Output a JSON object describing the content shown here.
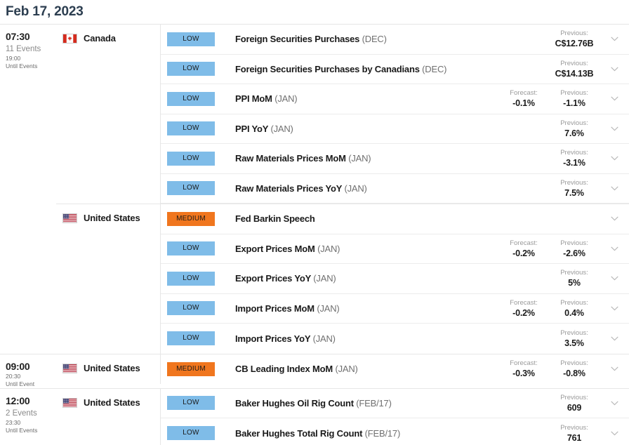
{
  "header": {
    "date": "Feb 17, 2023"
  },
  "labels": {
    "forecast": "Forecast:",
    "previous": "Previous:",
    "chevron_icon": "chevron-down-icon"
  },
  "groups": [
    {
      "time": "07:30",
      "events_count": "11 Events",
      "until_time": "19:00",
      "until_label": "Until Events",
      "countries": [
        {
          "name": "Canada",
          "flag": "canada-flag",
          "events": [
            {
              "impact": "LOW",
              "impact_level": "low",
              "title": "Foreign Securities Purchases",
              "period": "(DEC)",
              "forecast": "",
              "previous": "C$12.76B"
            },
            {
              "impact": "LOW",
              "impact_level": "low",
              "title": "Foreign Securities Purchases by Canadians",
              "period": "(DEC)",
              "forecast": "",
              "previous": "C$14.13B"
            },
            {
              "impact": "LOW",
              "impact_level": "low",
              "title": "PPI MoM",
              "period": "(JAN)",
              "forecast": "-0.1%",
              "previous": "-1.1%"
            },
            {
              "impact": "LOW",
              "impact_level": "low",
              "title": "PPI YoY",
              "period": "(JAN)",
              "forecast": "",
              "previous": "7.6%"
            },
            {
              "impact": "LOW",
              "impact_level": "low",
              "title": "Raw Materials Prices MoM",
              "period": "(JAN)",
              "forecast": "",
              "previous": "-3.1%"
            },
            {
              "impact": "LOW",
              "impact_level": "low",
              "title": "Raw Materials Prices YoY",
              "period": "(JAN)",
              "forecast": "",
              "previous": "7.5%"
            }
          ]
        },
        {
          "name": "United States",
          "flag": "usa-flag",
          "events": [
            {
              "impact": "MEDIUM",
              "impact_level": "medium",
              "title": "Fed Barkin Speech",
              "period": "",
              "forecast": "",
              "previous": ""
            },
            {
              "impact": "LOW",
              "impact_level": "low",
              "title": "Export Prices MoM",
              "period": "(JAN)",
              "forecast": "-0.2%",
              "previous": "-2.6%"
            },
            {
              "impact": "LOW",
              "impact_level": "low",
              "title": "Export Prices YoY",
              "period": "(JAN)",
              "forecast": "",
              "previous": "5%"
            },
            {
              "impact": "LOW",
              "impact_level": "low",
              "title": "Import Prices MoM",
              "period": "(JAN)",
              "forecast": "-0.2%",
              "previous": "0.4%"
            },
            {
              "impact": "LOW",
              "impact_level": "low",
              "title": "Import Prices YoY",
              "period": "(JAN)",
              "forecast": "",
              "previous": "3.5%"
            }
          ]
        }
      ]
    },
    {
      "time": "09:00",
      "events_count": "",
      "until_time": "20:30",
      "until_label": "Until Event",
      "countries": [
        {
          "name": "United States",
          "flag": "usa-flag",
          "events": [
            {
              "impact": "MEDIUM",
              "impact_level": "medium",
              "title": "CB Leading Index MoM",
              "period": "(JAN)",
              "forecast": "-0.3%",
              "previous": "-0.8%"
            }
          ]
        }
      ]
    },
    {
      "time": "12:00",
      "events_count": "2 Events",
      "until_time": "23:30",
      "until_label": "Until Events",
      "countries": [
        {
          "name": "United States",
          "flag": "usa-flag",
          "events": [
            {
              "impact": "LOW",
              "impact_level": "low",
              "title": "Baker Hughes Oil Rig Count",
              "period": "(FEB/17)",
              "forecast": "",
              "previous": "609"
            },
            {
              "impact": "LOW",
              "impact_level": "low",
              "title": "Baker Hughes Total Rig Count",
              "period": "(FEB/17)",
              "forecast": "",
              "previous": "761"
            }
          ]
        }
      ]
    }
  ],
  "colors": {
    "impact_low": "#7fbce8",
    "impact_medium": "#f0761e",
    "header_text": "#2c3e50",
    "border": "#e6e6e6"
  }
}
